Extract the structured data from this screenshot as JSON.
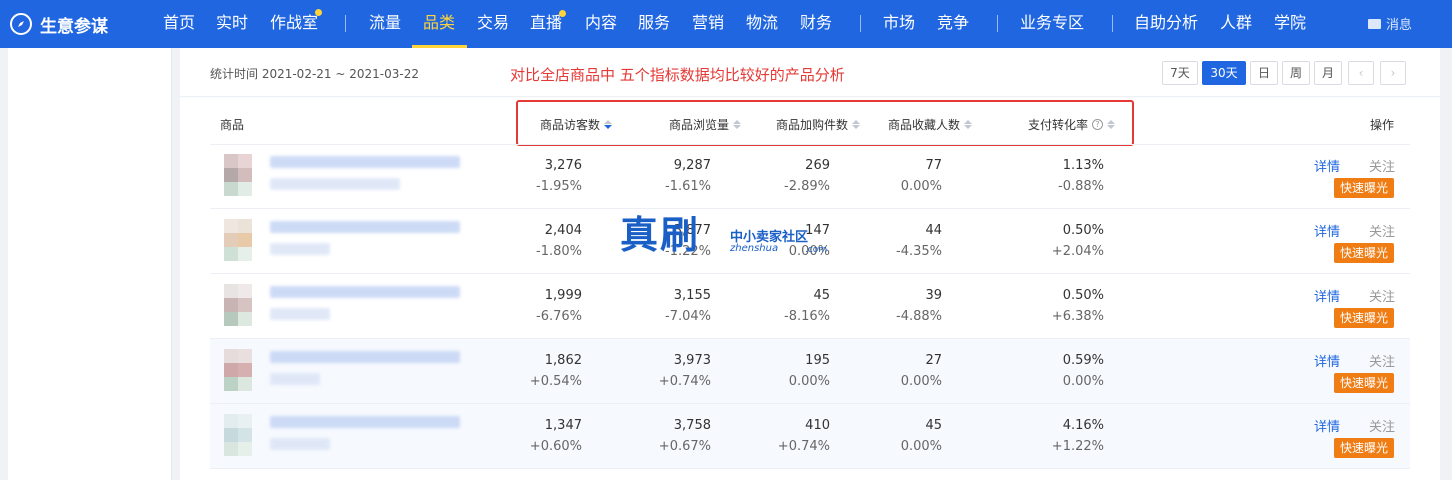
{
  "brand": {
    "name": "生意参谋"
  },
  "nav": {
    "items": [
      {
        "label": "首页"
      },
      {
        "label": "实时"
      },
      {
        "label": "作战室"
      },
      {
        "label": "流量"
      },
      {
        "label": "品类"
      },
      {
        "label": "交易"
      },
      {
        "label": "直播"
      },
      {
        "label": "内容"
      },
      {
        "label": "服务"
      },
      {
        "label": "营销"
      },
      {
        "label": "物流"
      },
      {
        "label": "财务"
      },
      {
        "label": "市场"
      },
      {
        "label": "竞争"
      },
      {
        "label": "业务专区"
      },
      {
        "label": "自助分析"
      },
      {
        "label": "人群"
      },
      {
        "label": "学院"
      }
    ],
    "active": "品类",
    "message_label": "消息",
    "accent_color": "#ffd43b",
    "bar_color": "#1f66e0"
  },
  "toolbar": {
    "stat_time": "统计时间 2021-02-21 ~ 2021-03-22",
    "annotation": "对比全店商品中  五个指标数据均比较好的产品分析",
    "periods": [
      {
        "label": "7天"
      },
      {
        "label": "30天"
      },
      {
        "label": "日"
      },
      {
        "label": "周"
      },
      {
        "label": "月"
      }
    ],
    "active_period": "30天",
    "prev_icon": "chevron-left-icon",
    "next_icon": "chevron-right-icon"
  },
  "table": {
    "columns": {
      "product": "商品",
      "visitors": "商品访客数",
      "views": "商品浏览量",
      "cart": "商品加购件数",
      "favorites": "商品收藏人数",
      "conversion": "支付转化率",
      "actions": "操作"
    },
    "sorted_column": "商品访客数",
    "sort_direction": "desc",
    "rows": [
      {
        "visitors": "3,276",
        "visitors_chg": "-1.95%",
        "views": "9,287",
        "views_chg": "-1.61%",
        "cart": "269",
        "cart_chg": "-2.89%",
        "favorites": "77",
        "favorites_chg": "0.00%",
        "conversion": "1.13%",
        "conversion_chg": "-0.88%"
      },
      {
        "visitors": "2,404",
        "visitors_chg": "-1.80%",
        "views": "3,877",
        "views_chg": "-1.22%",
        "cart": "147",
        "cart_chg": "0.00%",
        "favorites": "44",
        "favorites_chg": "-4.35%",
        "conversion": "0.50%",
        "conversion_chg": "+2.04%"
      },
      {
        "visitors": "1,999",
        "visitors_chg": "-6.76%",
        "views": "3,155",
        "views_chg": "-7.04%",
        "cart": "45",
        "cart_chg": "-8.16%",
        "favorites": "39",
        "favorites_chg": "-4.88%",
        "conversion": "0.50%",
        "conversion_chg": "+6.38%"
      },
      {
        "visitors": "1,862",
        "visitors_chg": "+0.54%",
        "views": "3,973",
        "views_chg": "+0.74%",
        "cart": "195",
        "cart_chg": "0.00%",
        "favorites": "27",
        "favorites_chg": "0.00%",
        "conversion": "0.59%",
        "conversion_chg": "0.00%"
      },
      {
        "visitors": "1,347",
        "visitors_chg": "+0.60%",
        "views": "3,758",
        "views_chg": "+0.67%",
        "cart": "410",
        "cart_chg": "+0.74%",
        "favorites": "45",
        "favorites_chg": "0.00%",
        "conversion": "4.16%",
        "conversion_chg": "+1.22%"
      }
    ],
    "actions": {
      "detail": "详情",
      "follow": "关注",
      "expose": "快速曝光"
    }
  },
  "watermark": {
    "big": "真刷",
    "small": "中小卖家社区",
    "url": "zhenshua",
    "domain": ".com"
  }
}
